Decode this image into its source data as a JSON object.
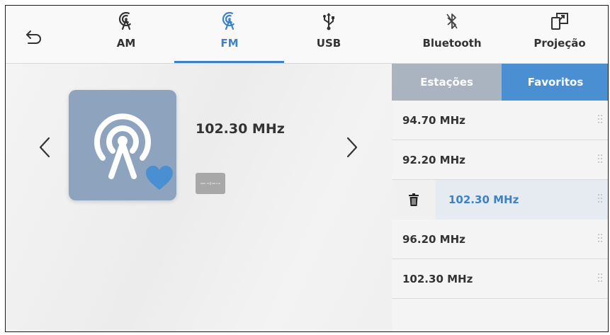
{
  "nav": {
    "tabs": [
      {
        "label": "AM",
        "icon": "radio-signal-icon"
      },
      {
        "label": "FM",
        "icon": "radio-signal-icon",
        "active": true
      },
      {
        "label": "USB",
        "icon": "usb-icon"
      },
      {
        "label": "Bluetooth",
        "icon": "bluetooth-icon"
      },
      {
        "label": "Projeção",
        "icon": "phone-projection-icon"
      }
    ]
  },
  "now_playing": {
    "frequency": "102.30 MHz",
    "favorite": true
  },
  "panel": {
    "stations_label": "Estações",
    "favorites_label": "Favoritos",
    "favorites": [
      {
        "label": "94.70 MHz"
      },
      {
        "label": "92.20 MHz"
      },
      {
        "label": "102.30 MHz",
        "selected": true
      },
      {
        "label": "96.20 MHz"
      },
      {
        "label": "102.30 MHz"
      }
    ]
  },
  "colors": {
    "accent": "#3d82c8",
    "favorites_tab": "#4b8fd3",
    "stations_tab": "#a9b4c0",
    "artwork_bg": "#8ea4be"
  }
}
